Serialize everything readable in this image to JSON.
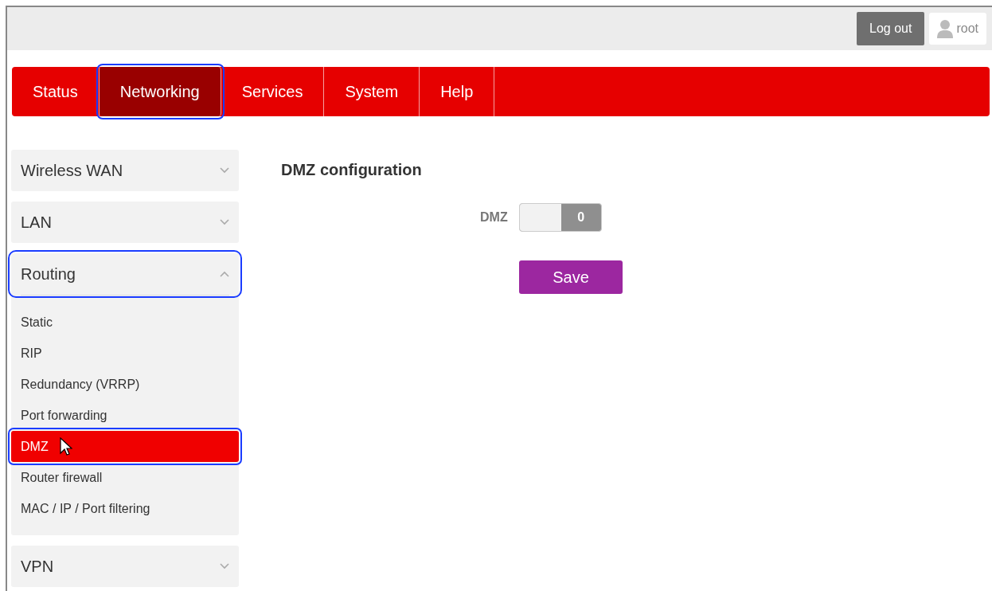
{
  "header": {
    "logout_button": "Log out",
    "user": "root"
  },
  "nav_tabs": [
    {
      "label": "Status",
      "selected": false,
      "highlighted": false
    },
    {
      "label": "Networking",
      "selected": true,
      "highlighted": true
    },
    {
      "label": "Services",
      "selected": false,
      "highlighted": false
    },
    {
      "label": "System",
      "selected": false,
      "highlighted": false
    },
    {
      "label": "Help",
      "selected": false,
      "highlighted": false
    }
  ],
  "sidebar": {
    "sections": [
      {
        "label": "Wireless WAN",
        "expanded": false,
        "highlighted": false
      },
      {
        "label": "LAN",
        "expanded": false,
        "highlighted": false
      },
      {
        "label": "Routing",
        "expanded": true,
        "highlighted": true,
        "items": [
          {
            "label": "Static",
            "selected": false,
            "highlighted": false
          },
          {
            "label": "RIP",
            "selected": false,
            "highlighted": false
          },
          {
            "label": "Redundancy (VRRP)",
            "selected": false,
            "highlighted": false
          },
          {
            "label": "Port forwarding",
            "selected": false,
            "highlighted": false
          },
          {
            "label": "DMZ",
            "selected": true,
            "highlighted": true
          },
          {
            "label": "Router firewall",
            "selected": false,
            "highlighted": false
          },
          {
            "label": "MAC / IP / Port filtering",
            "selected": false,
            "highlighted": false
          }
        ]
      },
      {
        "label": "VPN",
        "expanded": false,
        "highlighted": false
      }
    ]
  },
  "content": {
    "title": "DMZ configuration",
    "toggle": {
      "label": "DMZ",
      "on": false,
      "value": "0"
    },
    "save_button": "Save"
  }
}
